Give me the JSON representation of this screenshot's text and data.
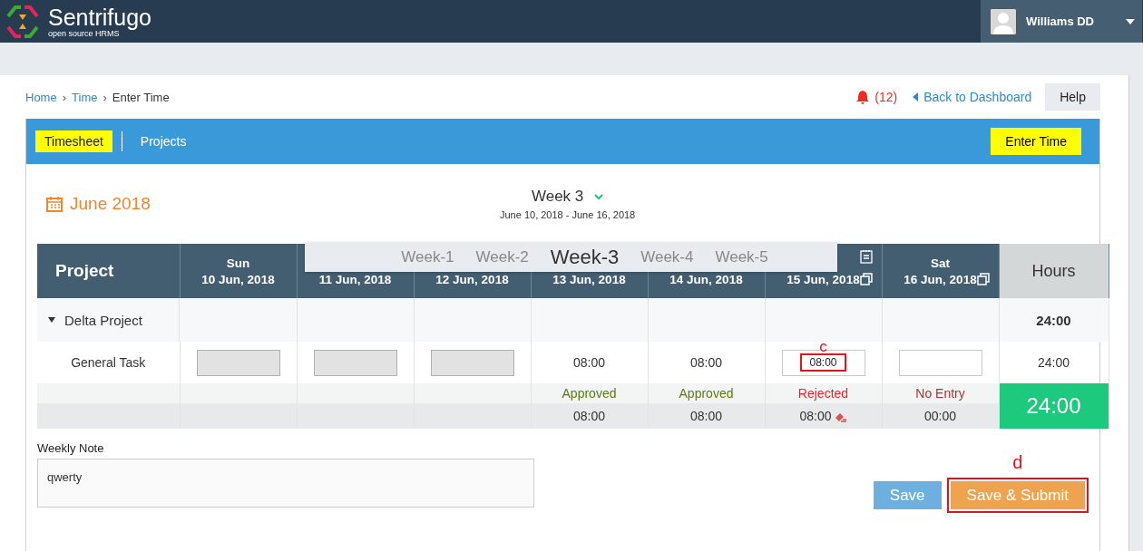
{
  "brand": {
    "name": "Sentrifugo",
    "tagline": "open source HRMS"
  },
  "user": {
    "name": "Williams DD"
  },
  "breadcrumb": [
    {
      "label": "Home",
      "link": true
    },
    {
      "separator": "›",
      "label": "Time",
      "link": true
    },
    {
      "separator": "›",
      "label": "Enter Time",
      "link": false
    }
  ],
  "notifications": {
    "count": "(12)"
  },
  "back_link": "Back to Dashboard",
  "help_button": "Help",
  "tabs": [
    {
      "label": "Timesheet",
      "selected": true
    },
    {
      "label": "Projects",
      "selected": false
    }
  ],
  "enter_time_button": "Enter Time",
  "month": "June 2018",
  "week": {
    "title": "Week 3",
    "range": "June 10, 2018 - June 16, 2018"
  },
  "week_picker": [
    {
      "label": "Week-1",
      "selected": false
    },
    {
      "label": "Week-2",
      "selected": false
    },
    {
      "label": "Week-3",
      "selected": true
    },
    {
      "label": "Week-4",
      "selected": false
    },
    {
      "label": "Week-5",
      "selected": false
    }
  ],
  "table": {
    "project_heading": "Project",
    "hours_heading": "Hours",
    "project": {
      "name": "Delta Project",
      "expanded": true,
      "hours": "24:00"
    },
    "task": {
      "name": "General Task",
      "hours": "24:00"
    },
    "grand_total": "24:00",
    "days": [
      {
        "day": "Sun",
        "date": "10 Jun, 2018",
        "entry": {
          "kind": "input",
          "disabled": true
        },
        "status": {
          "kind": "none"
        }
      },
      {
        "date": "11 Jun, 2018",
        "entry": {
          "kind": "input",
          "disabled": true
        },
        "status": {
          "kind": "none"
        }
      },
      {
        "date": "12 Jun, 2018",
        "entry": {
          "kind": "input",
          "disabled": true
        },
        "status": {
          "kind": "none"
        }
      },
      {
        "date": "13 Jun, 2018",
        "entry": {
          "kind": "text",
          "value": "08:00"
        },
        "status": {
          "kind": "approved",
          "label": "Approved"
        },
        "total": "08:00"
      },
      {
        "date": "14 Jun, 2018",
        "entry": {
          "kind": "text",
          "value": "08:00"
        },
        "status": {
          "kind": "approved",
          "label": "Approved"
        },
        "total": "08:00"
      },
      {
        "date": "15 Jun, 2018",
        "copy": true,
        "calendar": true,
        "entry": {
          "kind": "input",
          "value": "08:00",
          "disabled": false,
          "annotation": "c"
        },
        "status": {
          "kind": "rejected",
          "label": "Rejected"
        },
        "total": "08:00"
      },
      {
        "day": "Sat",
        "date": "16 Jun, 2018",
        "copy": true,
        "entry": {
          "kind": "input",
          "disabled": false
        },
        "status": {
          "kind": "noentry",
          "label": "No Entry"
        },
        "total": "00:00"
      }
    ]
  },
  "weekly_note": {
    "label": "Weekly Note",
    "value": "qwerty"
  },
  "buttons": [
    {
      "label": "Save",
      "kind": "save"
    },
    {
      "label": "Save & Submit",
      "kind": "submit",
      "annotation": "d"
    }
  ]
}
